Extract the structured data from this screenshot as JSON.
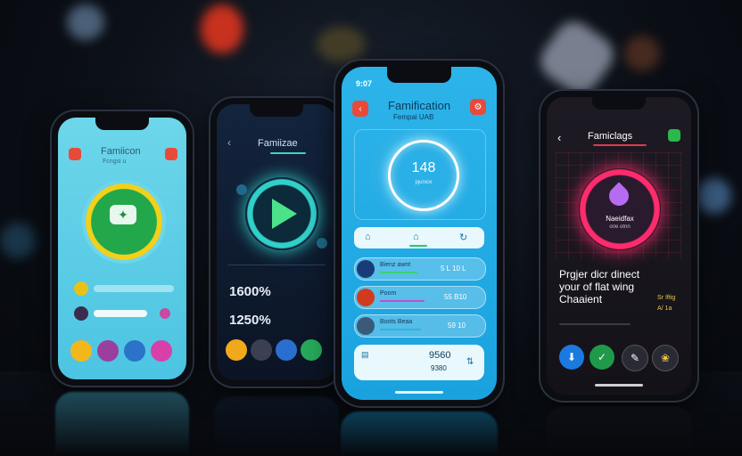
{
  "phone1": {
    "title": "Famiicon",
    "subtitle": "Fcngsi u"
  },
  "phone2": {
    "title": "Famiizae",
    "stat1": "1600%",
    "stat2": "1250%"
  },
  "phone3": {
    "status_time": "9:07",
    "title": "Famification",
    "subtitle": "Fempai UAB",
    "ring_value": "148",
    "ring_caption": "pjunice",
    "list": [
      {
        "label": "Bienz awnt",
        "value": "5 L 10 L"
      },
      {
        "label": "Poom",
        "value": "55 B10"
      },
      {
        "label": "Boots Beaa",
        "value": "59 10"
      }
    ],
    "footer_value": "9560",
    "footer_sub": "9380"
  },
  "phone4": {
    "title": "Famiclags",
    "ring_label": "Naeidfax",
    "ring_sub": "o0e otnn",
    "headline": "Prgjer dicr dinect your of flat wing Chaaient",
    "side1": "Sr Iftig",
    "side2": "A/ 1a"
  }
}
